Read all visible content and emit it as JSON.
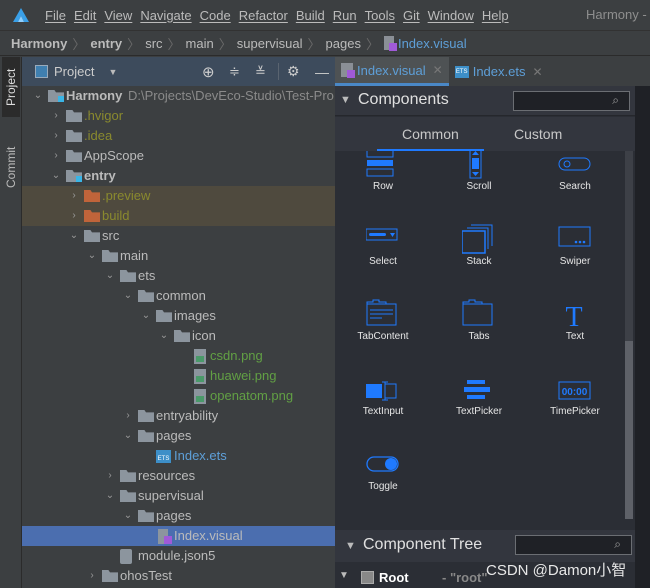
{
  "menubar": {
    "items": [
      "File",
      "Edit",
      "View",
      "Navigate",
      "Code",
      "Refactor",
      "Build",
      "Run",
      "Tools",
      "Git",
      "Window",
      "Help"
    ],
    "window_title": "Harmony -"
  },
  "breadcrumb": [
    "Harmony",
    "entry",
    "src",
    "main",
    "supervisual",
    "pages",
    "Index.visual"
  ],
  "side_tabs": {
    "project": "Project",
    "commit": "Commit"
  },
  "project_panel": {
    "title": "Project",
    "icons": [
      "locate-icon",
      "expand-all-icon",
      "collapse-all-icon",
      "gear-icon",
      "minimize-icon"
    ]
  },
  "tree": [
    {
      "label": "Harmony",
      "path": "D:\\Projects\\DevEco-Studio\\Test-Pro",
      "level": 0,
      "type": "module",
      "state": "open",
      "bold": true,
      "color": "#bbbbbb"
    },
    {
      "label": ".hvigor",
      "level": 1,
      "type": "folder",
      "state": "closed",
      "color": "#8a8a2e"
    },
    {
      "label": ".idea",
      "level": 1,
      "type": "folder",
      "state": "closed",
      "color": "#8a8a2e"
    },
    {
      "label": "AppScope",
      "level": 1,
      "type": "folder",
      "state": "closed",
      "color": "#bbbbbb"
    },
    {
      "label": "entry",
      "level": 1,
      "type": "module",
      "state": "open",
      "bold": true,
      "color": "#bbbbbb"
    },
    {
      "label": ".preview",
      "level": 2,
      "type": "excluded",
      "state": "closed",
      "color": "#8a8a2e",
      "ignored": true
    },
    {
      "label": "build",
      "level": 2,
      "type": "excluded",
      "state": "closed",
      "color": "#8a8a2e",
      "ignored": true
    },
    {
      "label": "src",
      "level": 2,
      "type": "folder",
      "state": "open",
      "color": "#bbbbbb"
    },
    {
      "label": "main",
      "level": 3,
      "type": "folder",
      "state": "open",
      "color": "#bbbbbb"
    },
    {
      "label": "ets",
      "level": 4,
      "type": "folder",
      "state": "open",
      "color": "#bbbbbb"
    },
    {
      "label": "common",
      "level": 5,
      "type": "folder",
      "state": "open",
      "color": "#bbbbbb"
    },
    {
      "label": "images",
      "level": 6,
      "type": "folder",
      "state": "open",
      "color": "#bbbbbb"
    },
    {
      "label": "icon",
      "level": 7,
      "type": "folder",
      "state": "open",
      "color": "#bbbbbb"
    },
    {
      "label": "csdn.png",
      "level": 8,
      "type": "image",
      "color": "#62a044"
    },
    {
      "label": "huawei.png",
      "level": 8,
      "type": "image",
      "color": "#62a044"
    },
    {
      "label": "openatom.png",
      "level": 8,
      "type": "image",
      "color": "#62a044"
    },
    {
      "label": "entryability",
      "level": 5,
      "type": "folder",
      "state": "closed",
      "color": "#bbbbbb"
    },
    {
      "label": "pages",
      "level": 5,
      "type": "folder",
      "state": "open",
      "color": "#bbbbbb"
    },
    {
      "label": "Index.ets",
      "level": 6,
      "type": "ets",
      "color": "#5e9fd8"
    },
    {
      "label": "resources",
      "level": 4,
      "type": "folder",
      "state": "closed",
      "color": "#bbbbbb"
    },
    {
      "label": "supervisual",
      "level": 4,
      "type": "folder",
      "state": "open",
      "color": "#bbbbbb"
    },
    {
      "label": "pages",
      "level": 5,
      "type": "folder",
      "state": "open",
      "color": "#bbbbbb"
    },
    {
      "label": "Index.visual",
      "level": 6,
      "type": "visual",
      "color": "#bbbbbb",
      "selected": true
    },
    {
      "label": "module.json5",
      "level": 4,
      "type": "json",
      "color": "#bbbbbb"
    },
    {
      "label": "ohosTest",
      "level": 3,
      "type": "folder",
      "state": "closed",
      "color": "#bbbbbb"
    }
  ],
  "editor_tabs": [
    {
      "label": "Index.visual",
      "active": true,
      "icon": "visual-file-icon"
    },
    {
      "label": "Index.ets",
      "active": false,
      "icon": "ets-file-icon"
    }
  ],
  "components": {
    "title": "Components",
    "tabs": [
      "Common",
      "Custom"
    ],
    "active_tab": "Common",
    "items": [
      {
        "label": "Row",
        "icon": "row-icon"
      },
      {
        "label": "Scroll",
        "icon": "scroll-icon"
      },
      {
        "label": "Search",
        "icon": "search-component-icon"
      },
      {
        "label": "Select",
        "icon": "select-icon"
      },
      {
        "label": "Stack",
        "icon": "stack-icon"
      },
      {
        "label": "Swiper",
        "icon": "swiper-icon"
      },
      {
        "label": "TabContent",
        "icon": "tabcontent-icon"
      },
      {
        "label": "Tabs",
        "icon": "tabs-icon"
      },
      {
        "label": "Text",
        "icon": "text-icon"
      },
      {
        "label": "TextInput",
        "icon": "textinput-icon"
      },
      {
        "label": "TextPicker",
        "icon": "textpicker-icon"
      },
      {
        "label": "TimePicker",
        "icon": "timepicker-icon",
        "icon_text": "00:00"
      },
      {
        "label": "Toggle",
        "icon": "toggle-icon"
      }
    ]
  },
  "component_tree": {
    "title": "Component Tree",
    "root": {
      "label": "Root",
      "id": "- \"root\""
    }
  },
  "watermark": "CSDN @Damon小智",
  "colors": {
    "accent": "#1f7aff",
    "selection": "#4b6eaf"
  }
}
